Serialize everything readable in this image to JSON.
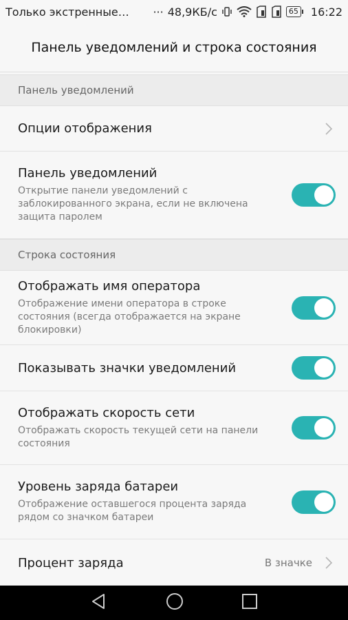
{
  "status_bar": {
    "carrier": "Только экстренные…",
    "dots": "···",
    "speed": "48,9КБ/с",
    "battery": "65",
    "time": "16:22"
  },
  "header": {
    "title": "Панель уведомлений и строка состояния"
  },
  "sections": {
    "notifications": "Панель уведомлений",
    "status": "Строка состояния"
  },
  "rows": {
    "display_options": {
      "title": "Опции отображения"
    },
    "notif_panel": {
      "title": "Панель уведомлений",
      "desc": "Открытие панели уведомлений с заблокированного экрана, если не включена защита паролем",
      "on": true
    },
    "operator": {
      "title": "Отображать имя оператора",
      "desc": "Отображение имени оператора в строке состояния (всегда отображается на экране блокировки)",
      "on": true
    },
    "icons": {
      "title": "Показывать значки уведомлений",
      "on": true
    },
    "speed": {
      "title": "Отображать скорость сети",
      "desc": "Отображать скорость текущей сети на панели состояния",
      "on": true
    },
    "battery_level": {
      "title": "Уровень заряда батареи",
      "desc": "Отображение оставшегося процента заряда рядом со значком батареи",
      "on": true
    },
    "charge_percent": {
      "title": "Процент заряда",
      "value": "В значке"
    }
  },
  "colors": {
    "accent": "#2ab3b3",
    "background": "#f7f7f7",
    "section": "#ececec"
  },
  "icons": [
    "vibrate-icon",
    "wifi-icon",
    "sim1-icon",
    "sim2-icon",
    "battery-icon",
    "chevron-right-icon",
    "back-icon",
    "home-icon",
    "recents-icon"
  ]
}
